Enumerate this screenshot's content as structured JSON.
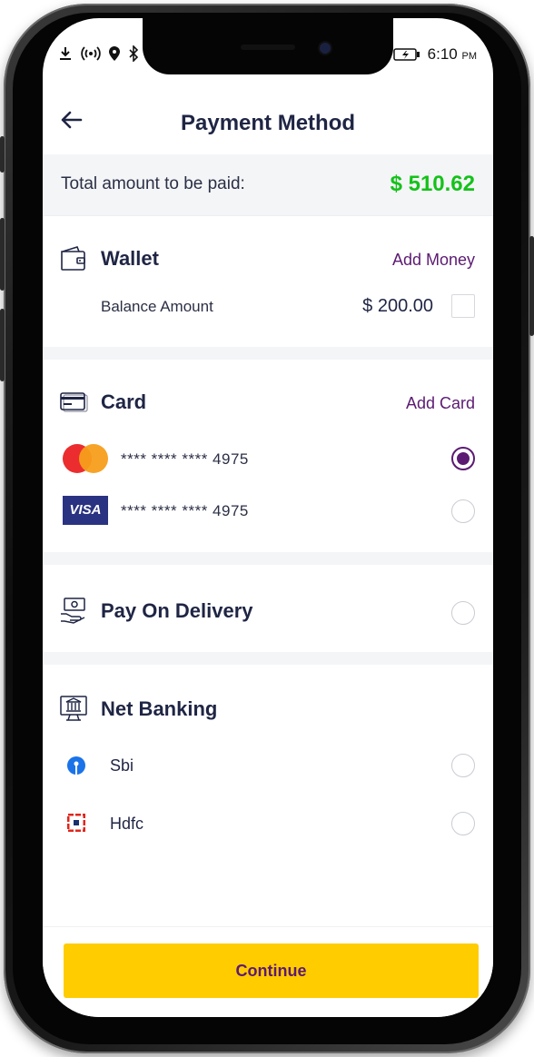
{
  "status_bar": {
    "time": "6:10",
    "ampm": "PM"
  },
  "header": {
    "title": "Payment Method"
  },
  "total": {
    "label": "Total amount to be paid:",
    "amount": "$ 510.62"
  },
  "wallet": {
    "title": "Wallet",
    "action": "Add Money",
    "balance_label": "Balance Amount",
    "balance": "$ 200.00",
    "checked": false
  },
  "card": {
    "title": "Card",
    "action": "Add Card",
    "cards": [
      {
        "brand": "mastercard",
        "number": "**** **** **** 4975",
        "selected": true
      },
      {
        "brand": "visa",
        "brand_label": "VISA",
        "number": "**** **** **** 4975",
        "selected": false
      }
    ]
  },
  "pay_on_delivery": {
    "title": "Pay On Delivery",
    "selected": false
  },
  "net_banking": {
    "title": "Net Banking",
    "banks": [
      {
        "name": "Sbi",
        "icon": "sbi-logo-icon",
        "selected": false
      },
      {
        "name": "Hdfc",
        "icon": "hdfc-logo-icon",
        "selected": false
      }
    ]
  },
  "footer": {
    "continue_label": "Continue"
  },
  "colors": {
    "accent": "#5c1a72",
    "total_green": "#14c21a",
    "button_yellow": "#ffcc00",
    "text_dark": "#1f2544"
  }
}
